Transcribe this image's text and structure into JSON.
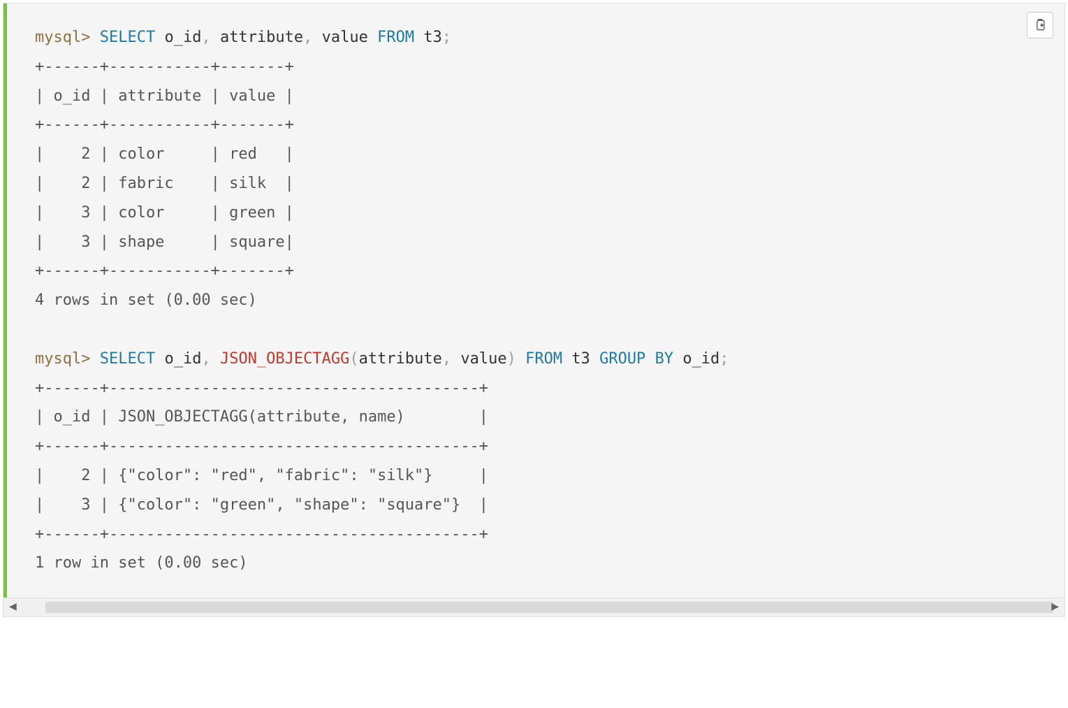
{
  "query1": {
    "prompt": "mysql>",
    "kw_select": "SELECT",
    "col1": "o_id",
    "col2": "attribute",
    "col3": "value",
    "kw_from": "FROM",
    "table": "t3",
    "semi": ";",
    "sep_line": "+------+-----------+-------+",
    "header_line": "| o_id | attribute | value |",
    "rows": [
      "|    2 | color     | red   |",
      "|    2 | fabric    | silk  |",
      "|    3 | color     | green |",
      "|    3 | shape     | square|"
    ],
    "footer": "4 rows in set (0.00 sec)"
  },
  "query2": {
    "prompt": "mysql>",
    "kw_select": "SELECT",
    "col1": "o_id",
    "fn": "JSON_OBJECTAGG",
    "arg1": "attribute",
    "arg2": "value",
    "kw_from": "FROM",
    "table": "t3",
    "kw_group": "GROUP",
    "kw_by": "BY",
    "group_col": "o_id",
    "semi": ";",
    "sep_line": "+------+----------------------------------------+",
    "header_line": "| o_id | JSON_OBJECTAGG(attribute, name)        |",
    "rows": [
      "|    2 | {\"color\": \"red\", \"fabric\": \"silk\"}     |",
      "|    3 | {\"color\": \"green\", \"shape\": \"square\"}  |"
    ],
    "footer": "1 row in set (0.00 sec)"
  },
  "copy_label": "Copy"
}
